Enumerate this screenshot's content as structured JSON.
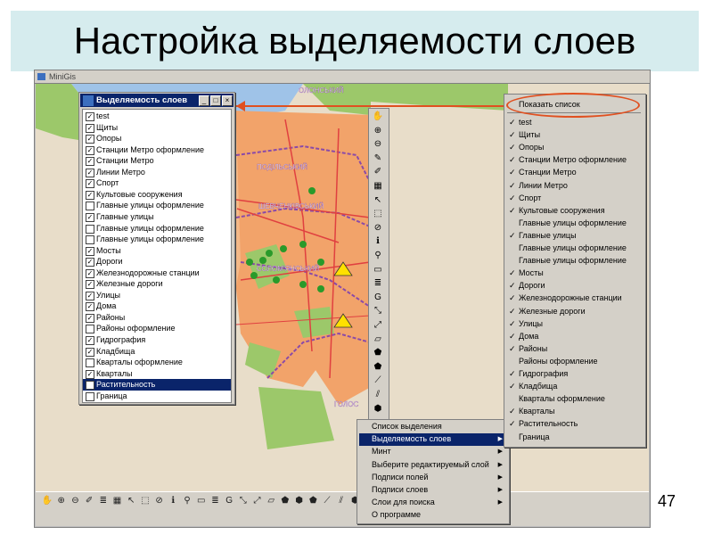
{
  "slide": {
    "title": "Настройка выделяемости слоев",
    "number": "47"
  },
  "app": {
    "title": "MiniGis"
  },
  "map": {
    "district_labels": [
      "ОЛОНСЬКИЙ",
      "ПОДІЛЬСЬКИЙ",
      "ШЕВЧЕНКІВСЬКИЙ",
      "СОЛОМ'ЯНСЬКИЙ",
      "ГОЛОС"
    ],
    "colors": {
      "background": "#e8ddc9",
      "urban": "#f2a36a",
      "green": "#9cc86a",
      "water": "#9fc3e8",
      "roads": "#e04040"
    }
  },
  "layer_panel": {
    "title": "Выделяемость слоев",
    "controls": {
      "minimize": "_",
      "maximize": "□",
      "close": "×"
    },
    "items": [
      {
        "label": "test",
        "checked": true
      },
      {
        "label": "Щиты",
        "checked": true
      },
      {
        "label": "Опоры",
        "checked": true
      },
      {
        "label": "Станции Метро оформление",
        "checked": true
      },
      {
        "label": "Станции Метро",
        "checked": true
      },
      {
        "label": "Линии Метро",
        "checked": true
      },
      {
        "label": "Спорт",
        "checked": true
      },
      {
        "label": "Культовые сооружения",
        "checked": true
      },
      {
        "label": "Главные улицы оформление",
        "checked": false
      },
      {
        "label": "Главные улицы",
        "checked": true
      },
      {
        "label": "Главные улицы оформление",
        "checked": false
      },
      {
        "label": "Главные улицы оформление",
        "checked": false
      },
      {
        "label": "Мосты",
        "checked": true
      },
      {
        "label": "Дороги",
        "checked": true
      },
      {
        "label": "Железнодорожные станции",
        "checked": true
      },
      {
        "label": "Железные дороги",
        "checked": true
      },
      {
        "label": "Улицы",
        "checked": true
      },
      {
        "label": "Дома",
        "checked": true
      },
      {
        "label": "Районы",
        "checked": true
      },
      {
        "label": "Районы оформление",
        "checked": false
      },
      {
        "label": "Гидрография",
        "checked": true
      },
      {
        "label": "Кладбища",
        "checked": true
      },
      {
        "label": "Кварталы оформление",
        "checked": false
      },
      {
        "label": "Кварталы",
        "checked": true
      },
      {
        "label": "Растительность",
        "checked": true,
        "selected": true
      },
      {
        "label": "Граница",
        "checked": false
      }
    ]
  },
  "tool_strip": {
    "tools": [
      "hand-icon",
      "zoom-in-icon",
      "zoom-out-icon",
      "pencil-icon",
      "edit-icon",
      "grid-icon",
      "pointer-icon",
      "select-rect-icon",
      "no-entry-icon",
      "info-icon",
      "binoculars-icon",
      "window-icon",
      "layers-icon",
      "g-icon",
      "pin-icon",
      "pin-alt-icon",
      "page-icon",
      "polygon-icon",
      "polygon-alt-icon",
      "line-icon",
      "hatch-icon",
      "polygon-fill-icon"
    ],
    "glyphs": [
      "✋",
      "⊕",
      "⊖",
      "✎",
      "✐",
      "▦",
      "↖",
      "⬚",
      "⊘",
      "ℹ",
      "⚲",
      "▭",
      "≣",
      "G",
      "⤡",
      "⤢",
      "▱",
      "⬟",
      "⬟",
      "⟋",
      "⫽",
      "⬢"
    ]
  },
  "context_menu": {
    "items": [
      {
        "label": "Список выделения",
        "submenu": false
      },
      {
        "label": "Выделяемость слоев",
        "submenu": true,
        "highlighted": true
      },
      {
        "label": "Минт",
        "submenu": true
      },
      {
        "label": "Выберите редактируемый слой",
        "submenu": true
      },
      {
        "label": "Подписи полей",
        "submenu": true
      },
      {
        "label": "Подписи слоев",
        "submenu": true
      },
      {
        "label": "Слои для поиска",
        "submenu": true
      },
      {
        "label": "О программе",
        "submenu": false
      }
    ]
  },
  "submenu": {
    "show_list": "Показать список",
    "items": [
      {
        "label": "test",
        "checked": true
      },
      {
        "label": "Щиты",
        "checked": true
      },
      {
        "label": "Опоры",
        "checked": true
      },
      {
        "label": "Станции Метро оформление",
        "checked": true
      },
      {
        "label": "Станции Метро",
        "checked": true
      },
      {
        "label": "Линии Метро",
        "checked": true
      },
      {
        "label": "Спорт",
        "checked": true
      },
      {
        "label": "Культовые сооружения",
        "checked": true
      },
      {
        "label": "Главные улицы оформление",
        "checked": false
      },
      {
        "label": "Главные улицы",
        "checked": true
      },
      {
        "label": "Главные улицы оформление",
        "checked": false
      },
      {
        "label": "Главные улицы оформление",
        "checked": false
      },
      {
        "label": "Мосты",
        "checked": true
      },
      {
        "label": "Дороги",
        "checked": true
      },
      {
        "label": "Железнодорожные станции",
        "checked": true
      },
      {
        "label": "Железные дороги",
        "checked": true
      },
      {
        "label": "Улицы",
        "checked": true
      },
      {
        "label": "Дома",
        "checked": true
      },
      {
        "label": "Районы",
        "checked": true
      },
      {
        "label": "Районы оформление",
        "checked": false
      },
      {
        "label": "Гидрография",
        "checked": true
      },
      {
        "label": "Кладбища",
        "checked": true
      },
      {
        "label": "Кварталы оформление",
        "checked": false
      },
      {
        "label": "Кварталы",
        "checked": true
      },
      {
        "label": "Растительность",
        "checked": true
      },
      {
        "label": "Граница",
        "checked": false
      }
    ]
  },
  "bottom_toolbar": {
    "glyphs": [
      "✋",
      "⊕",
      "⊖",
      "✐",
      "≣",
      "▦",
      "↖",
      "⬚",
      "⊘",
      "ℹ",
      "⚲",
      "▭",
      "≣",
      "G",
      "⤡",
      "⤢",
      "▱",
      "⬟",
      "⬢",
      "⬟",
      "⟋",
      "⫽",
      "⬢"
    ],
    "icons": [
      "hand-icon",
      "zoom-in-icon",
      "zoom-out-icon",
      "edit-icon",
      "list-icon",
      "grid-icon",
      "pointer-icon",
      "select-rect-icon",
      "no-entry-icon",
      "info-icon",
      "binoculars-icon",
      "window-icon",
      "layers-icon",
      "g-icon",
      "pin-icon",
      "pin-alt-icon",
      "page-icon",
      "polygon-icon",
      "polygon-fill-icon",
      "polygon-alt-icon",
      "line-icon",
      "hatch-icon",
      "shape-icon"
    ]
  }
}
